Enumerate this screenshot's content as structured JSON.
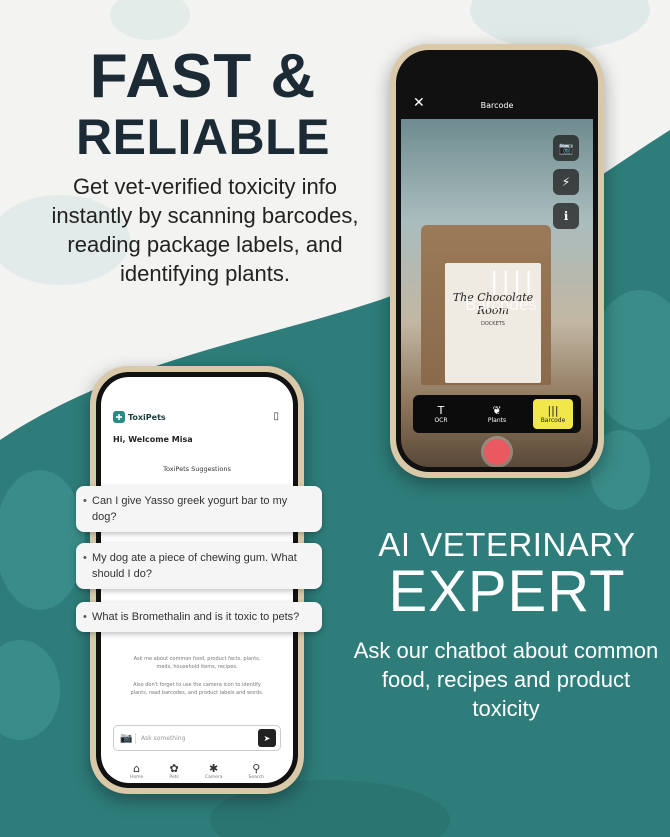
{
  "headline": {
    "line1": "FAST &",
    "line2": "RELIABLE"
  },
  "subtext": "Get vet-verified toxicity info instantly by scanning barcodes, reading package labels, and identifying plants.",
  "ai": {
    "line1": "AI VETERINARY",
    "line2": "EXPERT",
    "subtext": "Ask our chatbot about common food, recipes and product toxicity"
  },
  "camera": {
    "close": "✕",
    "title": "Barcode",
    "overlay_label": "Barcodes",
    "bag_text": "The Chocolate Room",
    "bag_small": "DOCKETS",
    "tabs": [
      {
        "label": "OCR",
        "icon": "T"
      },
      {
        "label": "Plants",
        "icon": "❦"
      },
      {
        "label": "Barcode",
        "icon": "|||"
      }
    ],
    "side_icons": [
      "📷",
      "⚡",
      "ℹ"
    ]
  },
  "chat": {
    "brand": "ToxiPets",
    "welcome": "Hi, Welcome Misa",
    "suggestions_title": "ToxiPets Suggestions",
    "suggestions": [
      "Can I give Yasso greek yogurt bar to my dog?",
      "My dog ate a piece of chewing gum. What should I do?",
      "What is Bromethalin and is it toxic to pets?"
    ],
    "disclaimer1": "Ask me about common food, product facts, plants, meds, household items, recipes.",
    "disclaimer2": "Also don't forget to use the camera icon to identify plants, read barcodes, and product labels and words.",
    "input_placeholder": "Ask something",
    "nav": [
      "Home",
      "Pets",
      "Camera",
      "Search"
    ]
  },
  "colors": {
    "teal": "#2e7d7a",
    "dark_text": "#1c2a36",
    "accent_yellow": "#f1e64a"
  }
}
